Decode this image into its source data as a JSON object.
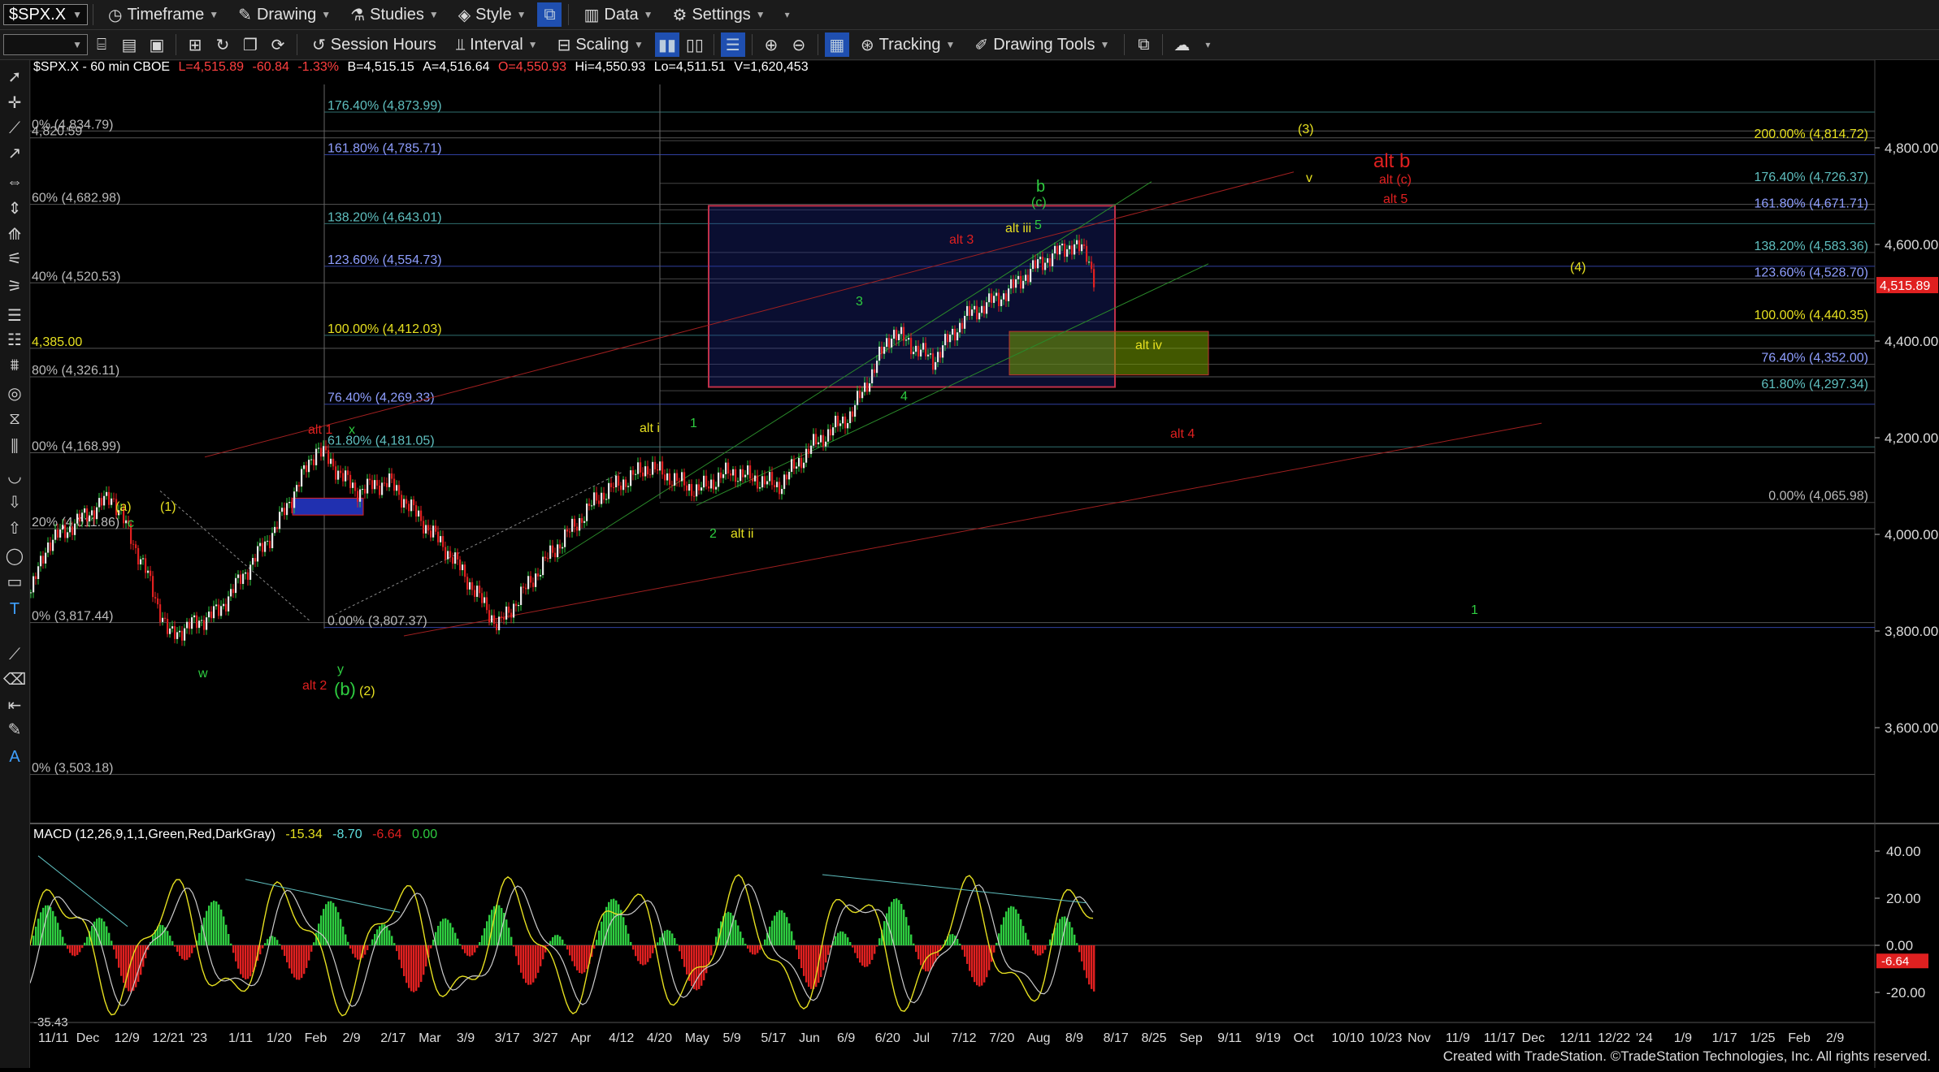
{
  "toolbar1": {
    "symbol": "$SPX.X",
    "items": [
      {
        "icon": "clock-icon",
        "label": "Timeframe"
      },
      {
        "icon": "pencil-icon",
        "label": "Drawing"
      },
      {
        "icon": "flask-icon",
        "label": "Studies"
      },
      {
        "icon": "palette-icon",
        "label": "Style"
      },
      {
        "icon": "chart-data-icon",
        "label": "Data"
      },
      {
        "icon": "gear-icon",
        "label": "Settings"
      }
    ]
  },
  "toolbar2": {
    "session_label": "Session Hours",
    "interval_label": "Interval",
    "scaling_label": "Scaling",
    "tracking_label": "Tracking",
    "drawing_tools_label": "Drawing Tools"
  },
  "chart_info": {
    "symbol": "$SPX.X - 60 min  CBOE",
    "last": "L=4,515.89",
    "change": "-60.84",
    "pct": "-1.33%",
    "bid": "B=4,515.15",
    "ask": "A=4,516.64",
    "open": "O=4,550.93",
    "hi": "Hi=4,550.93",
    "lo": "Lo=4,511.51",
    "vol": "V=1,620,453"
  },
  "macd_info": {
    "label": "MACD (12,26,9,1,1,Green,Red,DarkGray)",
    "v1": "-15.34",
    "v2": "-8.70",
    "v3": "-6.64",
    "v4": "0.00"
  },
  "price_axis": [
    "4,800.00",
    "4,600.00",
    "4,400.00",
    "4,200.00",
    "4,000.00",
    "3,800.00",
    "3,600.00"
  ],
  "last_price_label": "4,515.89",
  "macd_axis": [
    "40.00",
    "20.00",
    "0.00",
    "-20.00"
  ],
  "macd_last_label": "-6.64",
  "macd_low_label": "-35.43",
  "time_axis": [
    "11/11",
    "Dec",
    "12/9",
    "12/21",
    "'23",
    "1/11",
    "1/20",
    "Feb",
    "2/9",
    "2/17",
    "Mar",
    "3/9",
    "3/17",
    "3/27",
    "Apr",
    "4/12",
    "4/20",
    "May",
    "5/9",
    "5/17",
    "Jun",
    "6/9",
    "6/20",
    "Jul",
    "7/12",
    "7/20",
    "Aug",
    "8/9",
    "8/17",
    "8/25",
    "Sep",
    "9/11",
    "9/19",
    "Oct",
    "10/10",
    "10/23",
    "Nov",
    "11/9",
    "11/17",
    "Dec",
    "12/11",
    "12/22",
    "'24",
    "1/9",
    "1/17",
    "1/25",
    "Feb",
    "2/9"
  ],
  "fib_left": [
    "0% (4,834.79)",
    "4,820.59",
    "60% (4,682.98)",
    "40% (4,520.53)",
    "4,385.00",
    "80% (4,326.11)",
    "00% (4,168.99)",
    "20% (4,011.86)",
    "0% (3,817.44)",
    "0% (3,503.18)"
  ],
  "fib_mid": [
    "176.40% (4,873.99)",
    "161.80% (4,785.71)",
    "138.20% (4,643.01)",
    "123.60% (4,554.73)",
    "100.00% (4,412.03)",
    "76.40% (4,269.33)",
    "61.80% (4,181.05)",
    "0.00% (3,807.37)"
  ],
  "fib_right": [
    "200.00% (4,814.72)",
    "176.40% (4,726.37)",
    "161.80% (4,671.71)",
    "138.20% (4,583.36)",
    "123.60% (4,528.70)",
    "100.00% (4,440.35)",
    "76.40% (4,352.00)",
    "61.80% (4,297.34)",
    "0.00% (4,065.98)"
  ],
  "wave_labels": [
    "(a)",
    "(1)",
    "c",
    "w",
    "alt 1",
    "x",
    "alt 2",
    "y",
    "(b)",
    "(2)",
    "alt i",
    "1",
    "2",
    "alt ii",
    "3",
    "4",
    "alt 3",
    "alt iii",
    "5",
    "(c)",
    "b",
    "alt iv",
    "alt 4",
    "(3)",
    "v",
    "alt b",
    "alt (c)",
    "alt 5",
    "(4)",
    "1"
  ],
  "footer": "Created with TradeStation. ©TradeStation Technologies, Inc. All rights reserved.",
  "colors": {
    "green": "#2ecc40",
    "yellow": "#e6e020",
    "red": "#e02020",
    "blue": "#2f3fcf",
    "teal": "#5fbfbf",
    "accent": "#1f4fb0"
  }
}
